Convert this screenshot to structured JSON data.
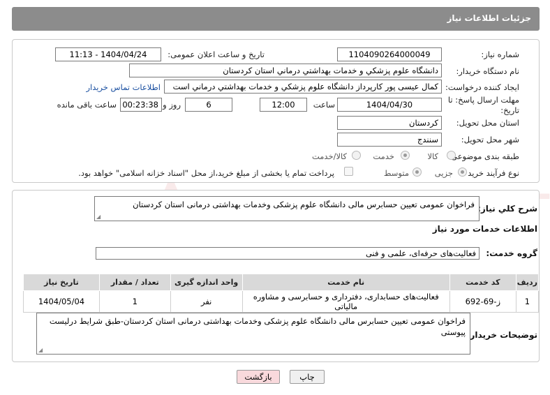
{
  "header": {
    "title": "جزئیات اطلاعات نیاز"
  },
  "form": {
    "need_number_label": "شماره نیاز:",
    "need_number": "1104090264000049",
    "announce_label": "تاریخ و ساعت اعلان عمومی:",
    "announce_value": "1404/04/24 - 11:13",
    "buyer_org_label": "نام دستگاه خریدار:",
    "buyer_org": "دانشگاه علوم پزشکي و خدمات بهداشتي  درماني استان کردستان",
    "creator_label": "ایجاد کننده درخواست:",
    "creator": "کمال عیسی پور کارپرداز دانشگاه علوم پزشکي و خدمات بهداشتي  درماني است",
    "contact_link": "اطلاعات تماس خریدار",
    "deadline_label_1": "مهلت ارسال پاسخ: تا",
    "deadline_label_2": "تاریخ:",
    "deadline_date": "1404/04/30",
    "time_label": "ساعت",
    "deadline_time": "12:00",
    "days_value": "6",
    "days_label": "روز و",
    "remaining_time": "00:23:38",
    "remaining_label": "ساعت باقی مانده",
    "province_label": "استان محل تحویل:",
    "province": "کردستان",
    "city_label": "شهر محل تحویل:",
    "city": "سنندج",
    "category_label": "طبقه بندی موضوعی:",
    "category_options": [
      "کالا",
      "خدمت",
      "کالا/خدمت"
    ],
    "category_selected": "خدمت",
    "process_label": "نوع فرآیند خرید :",
    "process_options": [
      "جزیی",
      "متوسط"
    ],
    "process_selected": "جزیی",
    "payment_note": "پرداخت تمام یا بخشی از مبلغ خرید،از محل \"اسناد خزانه اسلامی\" خواهد بود."
  },
  "summary": {
    "label": "شرح کلي نياز:",
    "text": "فراخوان عمومی تعیین حسابرس مالی دانشگاه علوم پزشکی وخدمات بهداشتی درمانی استان کردستان"
  },
  "services": {
    "section_title": "اطلاعات خدمات مورد نیاز",
    "group_label": "گروه خدمت:",
    "group_value": "فعالیت‌های حرفه‌ای، علمی و فنی",
    "columns": [
      "ردیف",
      "کد خدمت",
      "نام خدمت",
      "واحد اندازه گیری",
      "تعداد / مقدار",
      "تاریخ نیاز"
    ],
    "rows": [
      [
        "1",
        "ز-69-692",
        "فعالیت‌های حسابداری، دفترداری و حسابرسی و مشاوره مالیاتی",
        "نفر",
        "1",
        "1404/05/04"
      ]
    ]
  },
  "buyer_notes": {
    "label": "توضیحات خریدار:",
    "text": "فراخوان عمومی تعیین حسابرس مالی دانشگاه علوم پزشکی وخدمات بهداشتی درمانی استان کردستان-طبق شرایط درلیست پیوستی"
  },
  "buttons": {
    "print": "چاپ",
    "back": "بازگشت"
  },
  "watermark": {
    "text": "AriaTender.neT"
  },
  "colors": {
    "header_bg": "#8c8c8c",
    "link": "#1a4fa0",
    "back_button": "#f9d9dc",
    "watermark": "#c62828"
  }
}
